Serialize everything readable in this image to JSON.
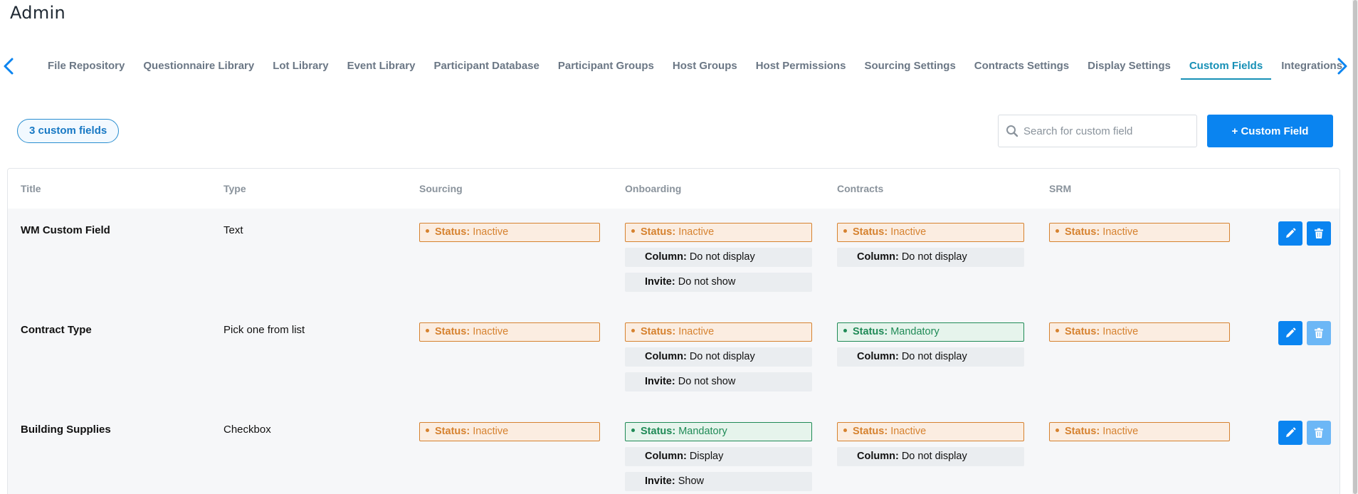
{
  "page": {
    "title": "Admin"
  },
  "tabs": [
    {
      "label": "File Repository",
      "active": false
    },
    {
      "label": "Questionnaire Library",
      "active": false
    },
    {
      "label": "Lot Library",
      "active": false
    },
    {
      "label": "Event Library",
      "active": false
    },
    {
      "label": "Participant Database",
      "active": false
    },
    {
      "label": "Participant Groups",
      "active": false
    },
    {
      "label": "Host Groups",
      "active": false
    },
    {
      "label": "Host Permissions",
      "active": false
    },
    {
      "label": "Sourcing Settings",
      "active": false
    },
    {
      "label": "Contracts Settings",
      "active": false
    },
    {
      "label": "Display Settings",
      "active": false
    },
    {
      "label": "Custom Fields",
      "active": true
    },
    {
      "label": "Integrations",
      "active": false
    }
  ],
  "toolbar": {
    "count_label": "3 custom fields",
    "search_placeholder": "Search for custom field",
    "add_label": "+ Custom Field"
  },
  "table": {
    "headers": {
      "title": "Title",
      "type": "Type",
      "sourcing": "Sourcing",
      "onboarding": "Onboarding",
      "contracts": "Contracts",
      "srm": "SRM"
    },
    "labels": {
      "status": "Status:",
      "column": "Column:",
      "invite": "Invite:"
    },
    "rows": [
      {
        "title": "WM Custom Field",
        "type": "Text",
        "sourcing_status": "Inactive",
        "onboarding_status": "Inactive",
        "onboarding_column": "Do not display",
        "onboarding_invite": "Do not show",
        "contracts_status": "Inactive",
        "contracts_column": "Do not display",
        "srm_status": "Inactive",
        "delete_enabled": true
      },
      {
        "title": "Contract Type",
        "type": "Pick one from list",
        "sourcing_status": "Inactive",
        "onboarding_status": "Inactive",
        "onboarding_column": "Do not display",
        "onboarding_invite": "Do not show",
        "contracts_status": "Mandatory",
        "contracts_column": "Do not display",
        "srm_status": "Inactive",
        "delete_enabled": false
      },
      {
        "title": "Building Supplies",
        "type": "Checkbox",
        "sourcing_status": "Inactive",
        "onboarding_status": "Mandatory",
        "onboarding_column": "Display",
        "onboarding_invite": "Show",
        "contracts_status": "Inactive",
        "contracts_column": "Do not display",
        "srm_status": "Inactive",
        "delete_enabled": false
      }
    ]
  },
  "icons": {
    "tab_prev": "chevron-left-icon",
    "tab_next": "chevron-right-icon",
    "search": "search-icon",
    "edit": "pencil-icon",
    "delete": "trash-icon"
  },
  "colors": {
    "accent": "#0a84f0",
    "tab_active": "#1790b6",
    "inactive": "#d6822f",
    "mandatory": "#1f8a56"
  }
}
